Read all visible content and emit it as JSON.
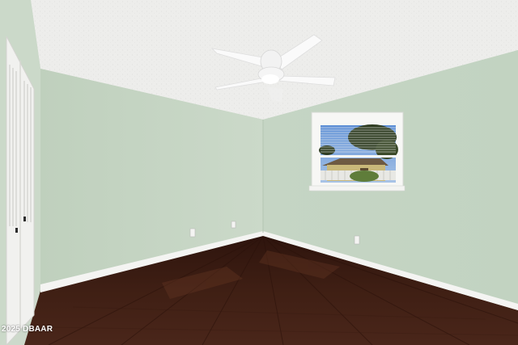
{
  "photo": {
    "watermark": "2025 DBAAR"
  },
  "colors": {
    "ceiling": "#eeeeec",
    "wall_left": "#c9d8c8",
    "wall_back": "#c3d3c2",
    "wall_right": "#c7d6c5",
    "floor": "#3d1e14",
    "baseboard": "#f4f4f2",
    "window_frame": "#f7f7f5"
  }
}
